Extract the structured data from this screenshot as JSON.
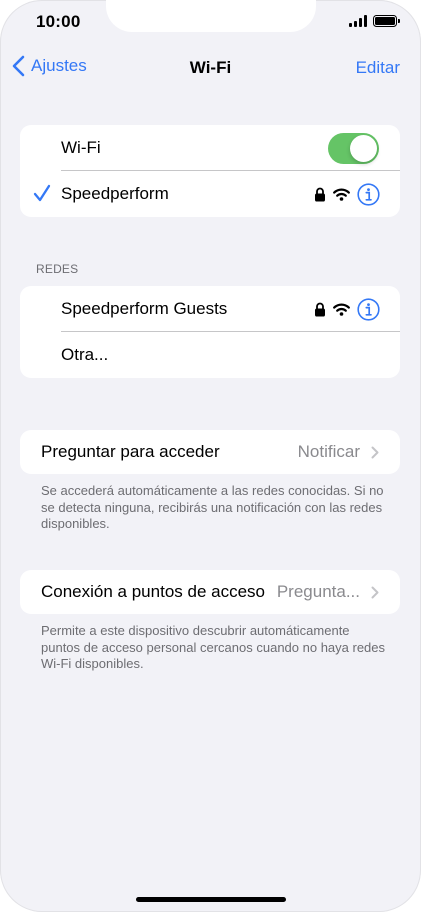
{
  "status": {
    "time": "10:00"
  },
  "nav": {
    "back_label": "Ajustes",
    "title": "Wi-Fi",
    "edit_label": "Editar"
  },
  "wifi_group": {
    "toggle_label": "Wi-Fi",
    "toggle_on": true,
    "connected_network": "Speedperform"
  },
  "networks": {
    "header": "REDES",
    "items": [
      {
        "name": "Speedperform Guests",
        "secured": true
      },
      {
        "name": "Otra..."
      }
    ]
  },
  "ask_to_join": {
    "label": "Preguntar para acceder",
    "value": "Notificar",
    "footnote": "Se accederá automáticamente a las redes conocidas. Si no se detecta ninguna, recibirás una notificación con las redes disponibles."
  },
  "hotspot": {
    "label": "Conexión a puntos de acceso",
    "value": "Pregunta...",
    "footnote": "Permite a este dispositivo descubrir automáticamente puntos de acceso personal cercanos cuando no haya redes Wi-Fi disponibles."
  },
  "colors": {
    "accent": "#3478f6",
    "toggle_on": "#65c466",
    "background": "#f2f2f7",
    "secondary_text": "#6d6d72"
  },
  "icons": [
    "chevron-left-icon",
    "checkmark-icon",
    "lock-icon",
    "wifi-icon",
    "info-icon",
    "chevron-right-icon",
    "cellular-signal-icon",
    "battery-icon"
  ]
}
